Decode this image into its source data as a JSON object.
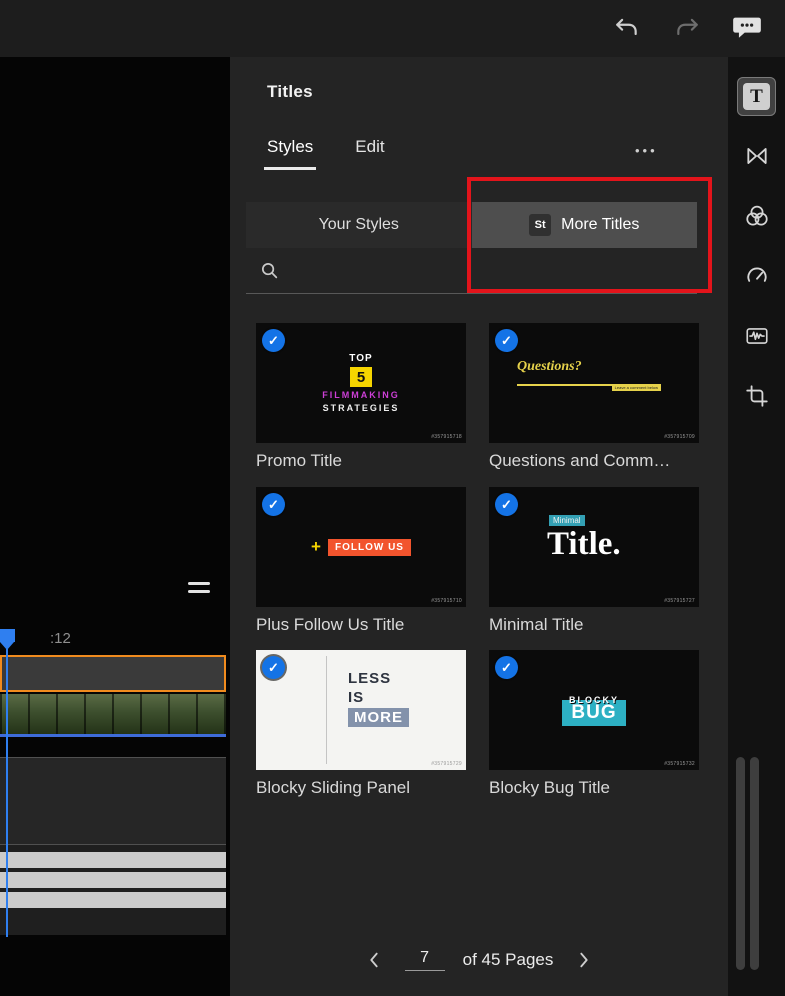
{
  "panel": {
    "title": "Titles",
    "tabs": [
      {
        "label": "Styles",
        "active": true
      },
      {
        "label": "Edit",
        "active": false
      }
    ],
    "overflow_menu": "•••",
    "segmented_control": [
      {
        "label": "Your Styles",
        "active": false
      },
      {
        "label": "More Titles",
        "active": true,
        "badge": "St"
      }
    ],
    "search": {
      "placeholder": ""
    },
    "templates": [
      {
        "name": "Promo Title",
        "selected": true,
        "watermark": "#357915718"
      },
      {
        "name": "Questions and Comm…",
        "selected": true,
        "watermark": "#357915709"
      },
      {
        "name": "Plus Follow Us Title",
        "selected": true,
        "watermark": "#357915710"
      },
      {
        "name": "Minimal Title",
        "selected": true,
        "watermark": "#357915727"
      },
      {
        "name": "Blocky Sliding Panel",
        "selected": true,
        "watermark": "#357915729"
      },
      {
        "name": "Blocky Bug Title",
        "selected": true,
        "watermark": "#357915732"
      }
    ],
    "pagination": {
      "page": "7",
      "label": "of 45 Pages"
    }
  },
  "thumbs": {
    "promo": {
      "kicker": "TOP",
      "number": "5",
      "line1": "FILMMAKING",
      "line2": "STRATEGIES"
    },
    "questions": {
      "title": "Questions?",
      "sub": "Leave a comment below"
    },
    "follow": {
      "plus": "+",
      "label": "FOLLOW US"
    },
    "minimal": {
      "tag": "Minimal",
      "title": "Title."
    },
    "blocky_panel": {
      "l1": "LESS",
      "l2": "IS",
      "l3": "MORE"
    },
    "blocky_bug": {
      "top": "BLOCKY",
      "title": "BUG"
    }
  },
  "toolbar": {
    "titles_glyph": "T"
  },
  "timeline": {
    "timecode": ":12"
  },
  "glyphs": {
    "check": "✓"
  },
  "colors": {
    "accent_blue": "#1473e6",
    "annotation_red": "#e3141b",
    "selection_orange": "#f08b1e",
    "stock_yellow": "#e6d24b"
  }
}
